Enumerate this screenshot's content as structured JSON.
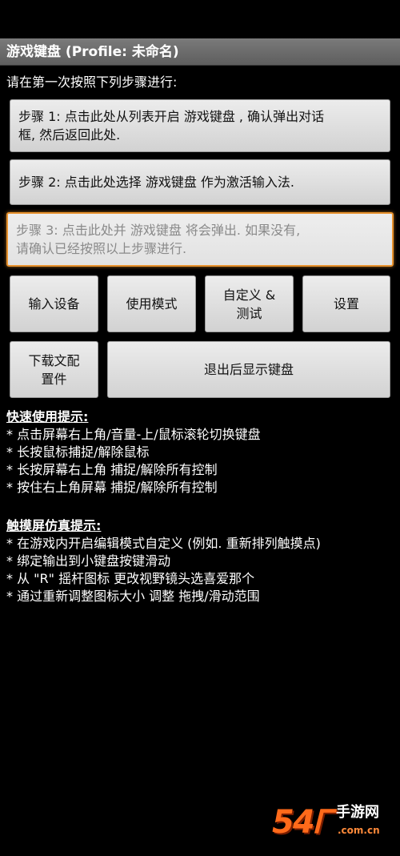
{
  "title": "游戏键盘 (Profile: 未命名)",
  "instruction": "请在第一次按照下列步骤进行:",
  "steps": [
    {
      "line1": "步骤 1: 点击此处从列表开启 游戏键盘 , 确认弹出对话",
      "line2": "框, 然后返回此处."
    },
    {
      "line1": "步骤 2: 点击此处选择 游戏键盘 作为激活输入法."
    },
    {
      "line1": "步骤 3: 点击此处并 游戏键盘 将会弹出. 如果没有,",
      "line2": "请确认已经按照以上步骤进行."
    }
  ],
  "buttons": {
    "input_device": "输入设备",
    "use_mode": "使用模式",
    "customize_line1": "自定义 &",
    "customize_line2": "测试",
    "settings": "设置",
    "download_line1": "下载文配",
    "download_line2": "置件",
    "exit_show_keyboard": "退出后显示键盘"
  },
  "quick_tips": {
    "title": "快速使用提示:",
    "items": [
      "* 点击屏幕右上角/音量-上/鼠标滚轮切换键盘",
      "* 长按鼠标捕捉/解除鼠标",
      "* 长按屏幕右上角 捕捉/解除所有控制",
      "* 按住右上角屏幕 捕捉/解除所有控制"
    ]
  },
  "touch_tips": {
    "title": "触摸屏仿真提示:",
    "items": [
      "* 在游戏内开启编辑模式自定义 (例如. 重新排列触摸点)",
      "* 绑定输出到小键盘按键滑动",
      "* 从 \"R\" 摇杆图标 更改视野镜头选喜爱那个",
      "* 通过重新调整图标大小 调整 拖拽/滑动范围"
    ]
  },
  "watermark": {
    "number": "54",
    "glyph": "Ꮁ",
    "text": "手游网",
    "sub": ".com.cn"
  },
  "colors": {
    "background": "#000000",
    "titlebar": "#6e6e6e",
    "button": "#e0e0e0",
    "focus_border": "#e8922e"
  }
}
